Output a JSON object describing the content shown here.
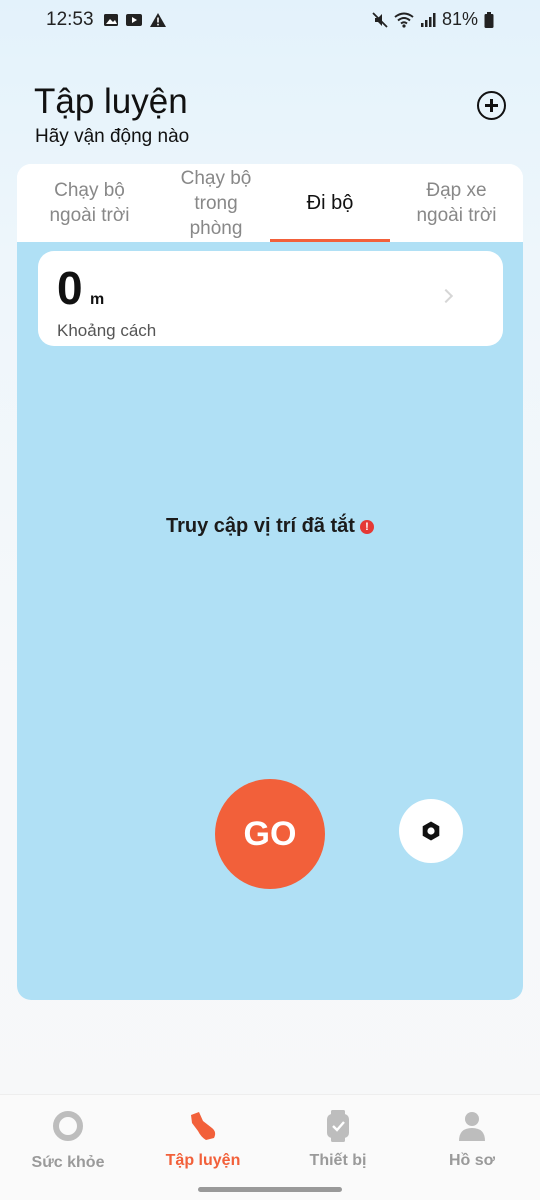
{
  "status_bar": {
    "time": "12:53",
    "battery": "81%",
    "left_icons": [
      "gallery-icon",
      "youtube-icon",
      "warning-icon"
    ],
    "right_icons": [
      "mute-icon",
      "wifi-icon",
      "signal-icon",
      "battery-icon"
    ]
  },
  "header": {
    "title": "Tập luyện",
    "subtitle": "Hãy vận động nào",
    "add_icon": "plus-circle-icon"
  },
  "tabs": [
    {
      "line1": "Chạy bộ",
      "line2": "ngoài trời",
      "line3": "",
      "active": false
    },
    {
      "line1": "Chạy bộ",
      "line2": "trong",
      "line3": "phòng",
      "active": false
    },
    {
      "line1": "Đi bộ",
      "line2": "",
      "line3": "",
      "active": true
    },
    {
      "line1": "Đạp xe",
      "line2": "ngoài trời",
      "line3": "",
      "active": false
    }
  ],
  "distance": {
    "value": "0",
    "unit": "m",
    "label": "Khoảng cách"
  },
  "location_message": "Truy cập vị trí đã tắt",
  "go_label": "GO",
  "bottom_nav": [
    {
      "label": "Sức khỏe",
      "icon": "ring-icon",
      "active": false
    },
    {
      "label": "Tập luyện",
      "icon": "shoe-icon",
      "active": true
    },
    {
      "label": "Thiết bị",
      "icon": "watch-icon",
      "active": false
    },
    {
      "label": "Hồ sơ",
      "icon": "person-icon",
      "active": false
    }
  ],
  "colors": {
    "accent": "#f2603a",
    "map_background": "#b0e0f5",
    "alert": "#e53935"
  }
}
